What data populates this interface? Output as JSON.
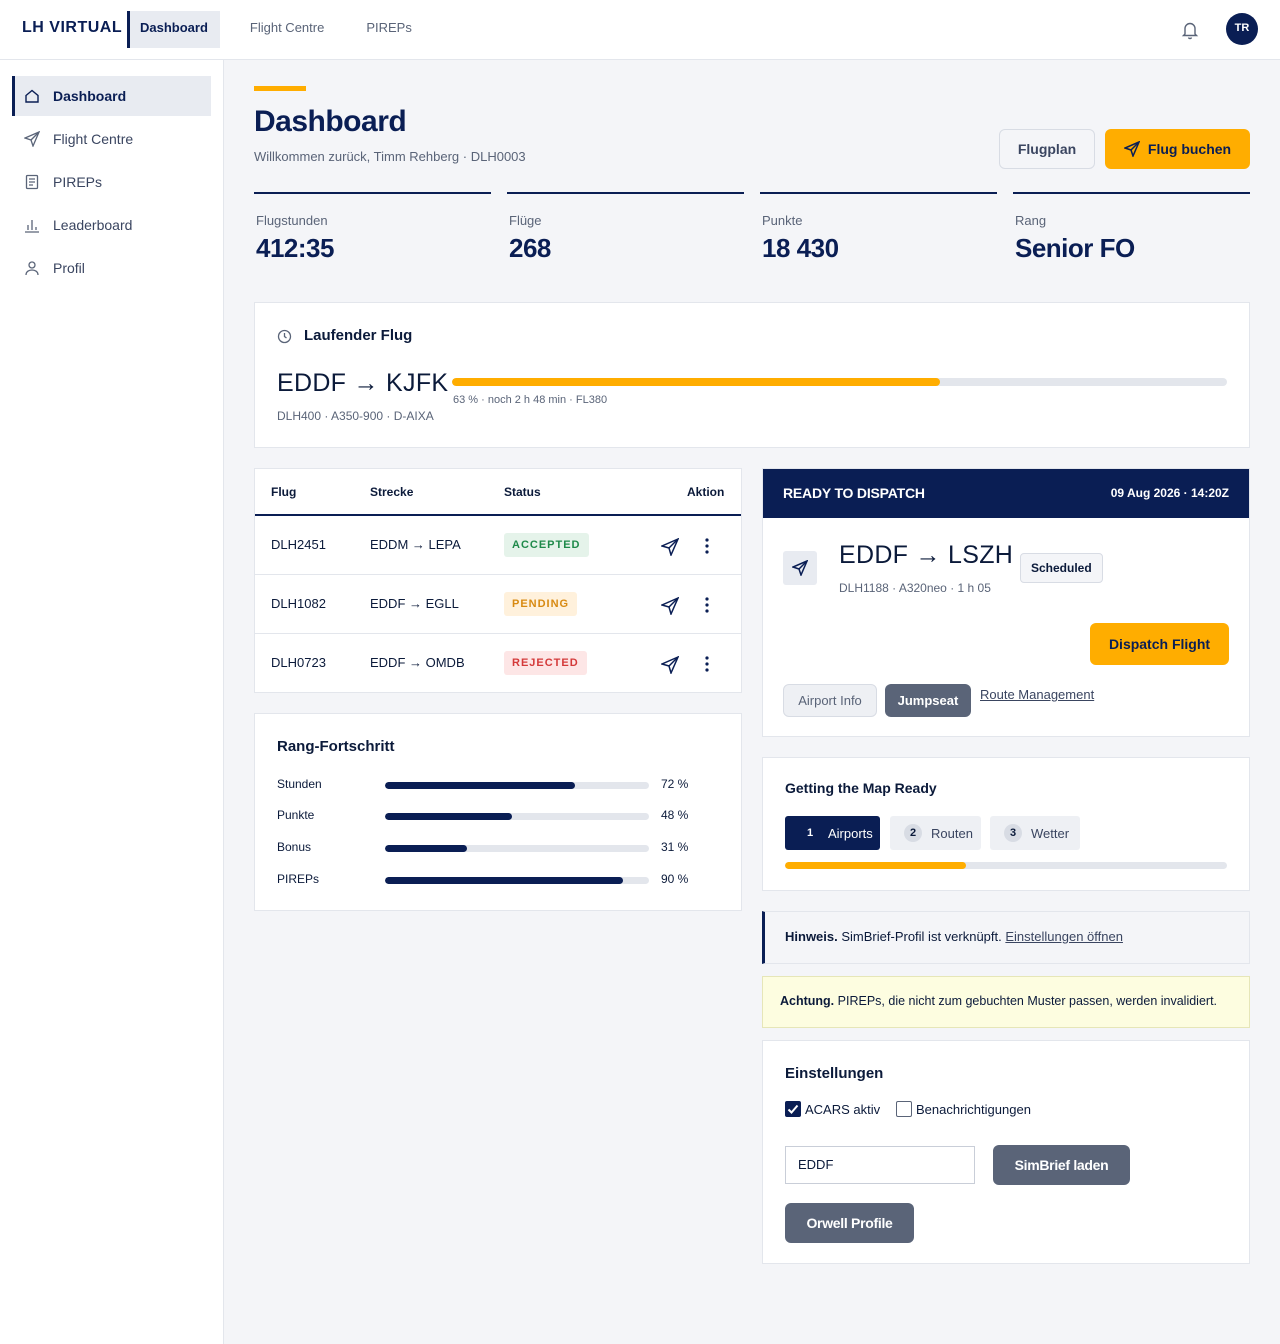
{
  "brand": "LH VIRTUAL",
  "topnav": [
    {
      "label": "Dashboard",
      "active": true
    },
    {
      "label": "Flight Centre",
      "active": false
    },
    {
      "label": "PIREPs",
      "active": false
    }
  ],
  "user": {
    "initials": "TR"
  },
  "sidebar": {
    "items": [
      {
        "label": "Dashboard",
        "icon": "home-icon",
        "active": true
      },
      {
        "label": "Flight Centre",
        "icon": "send-icon",
        "active": false
      },
      {
        "label": "PIREPs",
        "icon": "document-icon",
        "active": false
      },
      {
        "label": "Leaderboard",
        "icon": "bar-chart-icon",
        "active": false
      },
      {
        "label": "Profil",
        "icon": "user-icon",
        "active": false
      }
    ]
  },
  "header": {
    "title": "Dashboard",
    "subtitle": "Willkommen zurück, Timm Rehberg · DLH0003",
    "plan_label": "Flugplan",
    "book_label": "Flug buchen"
  },
  "stats": [
    {
      "label": "Flugstunden",
      "value": "412:35"
    },
    {
      "label": "Flüge",
      "value": "268"
    },
    {
      "label": "Punkte",
      "value": "18 430"
    },
    {
      "label": "Rang",
      "value": "Senior FO"
    }
  ],
  "current_flight": {
    "title": "Laufender Flug",
    "route": "EDDF → KJFK",
    "meta": "DLH400 · A350-900 · D-AIXA",
    "progress": 0.63,
    "progress_text": "63 % · noch 2 h 48 min · FL380"
  },
  "flights_table": {
    "headers": {
      "flight": "Flug",
      "route": "Strecke",
      "status": "Status",
      "action": "Aktion"
    },
    "rows": [
      {
        "flight": "DLH2451",
        "route": "EDDM → LEPA",
        "status": "ACCEPTED",
        "kind": "acc"
      },
      {
        "flight": "DLH1082",
        "route": "EDDF → EGLL",
        "status": "PENDING",
        "kind": "pen"
      },
      {
        "flight": "DLH0723",
        "route": "EDDF → OMDB",
        "status": "REJECTED",
        "kind": "rej"
      }
    ]
  },
  "rank_progress": {
    "title": "Rang-Fortschritt",
    "items": [
      {
        "label": "Stunden",
        "value": 72,
        "text": "72 %"
      },
      {
        "label": "Punkte",
        "value": 48,
        "text": "48 %"
      },
      {
        "label": "Bonus",
        "value": 31,
        "text": "31 %"
      },
      {
        "label": "PIREPs",
        "value": 90,
        "text": "90 %"
      }
    ]
  },
  "dispatch": {
    "title": "READY TO DISPATCH",
    "datetime": "09 Aug 2026 · 14:20Z",
    "route": "EDDF → LSZH",
    "meta": "DLH1188 · A320neo · 1 h 05",
    "badge": "Scheduled",
    "dispatch_label": "Dispatch Flight",
    "airport_info_label": "Airport Info",
    "jumpseat_label": "Jumpseat",
    "route_mgmt_label": "Route Management"
  },
  "map_ready": {
    "title": "Getting the Map Ready",
    "steps": [
      {
        "num": "1",
        "label": "Airports",
        "active": true
      },
      {
        "num": "2",
        "label": "Routen",
        "active": false
      },
      {
        "num": "3",
        "label": "Wetter",
        "active": false
      }
    ],
    "progress": 0.41
  },
  "notice": {
    "bold": "Hinweis.",
    "text": "SimBrief-Profil ist verknüpft.",
    "link": "Einstellungen öffnen"
  },
  "warning": {
    "bold": "Achtung.",
    "text": "PIREPs, die nicht zum gebuchten Muster passen, werden invalidiert."
  },
  "settings": {
    "title": "Einstellungen",
    "acars_label": "ACARS aktiv",
    "acars_checked": true,
    "notif_label": "Benachrichtigungen",
    "notif_checked": false,
    "input_value": "EDDF",
    "simbrief_label": "SimBrief laden",
    "orwell_label": "Orwell Profile"
  },
  "colors": {
    "navy": "#0a1e54",
    "accent": "#ffad00",
    "slate": "#5a6478"
  }
}
